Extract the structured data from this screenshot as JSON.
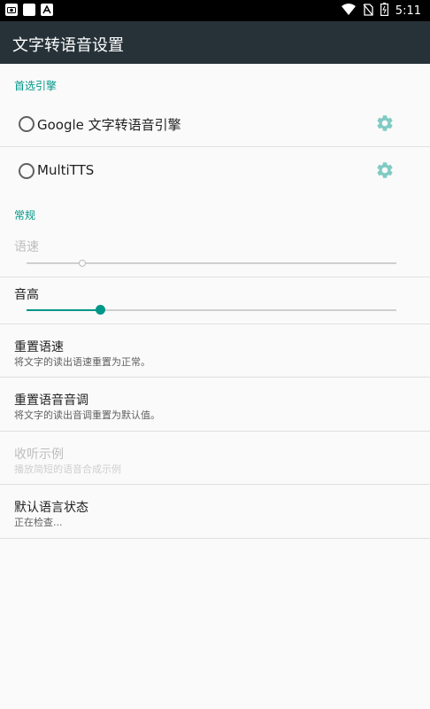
{
  "status_bar": {
    "time": "5:11",
    "left_icons": [
      "camera-icon",
      "square-icon",
      "a-icon"
    ],
    "right_icons": [
      "wifi-icon",
      "no-sim-icon",
      "battery-icon"
    ]
  },
  "toolbar": {
    "title": "文字转语音设置"
  },
  "preferred_engine": {
    "header": "首选引擎",
    "engines": [
      {
        "label": "Google 文字转语音引擎",
        "selected": false
      },
      {
        "label": "MultiTTS",
        "selected": false
      }
    ]
  },
  "general": {
    "header": "常规",
    "speech_rate": {
      "title": "语速",
      "enabled": false,
      "level": 0.15
    },
    "pitch": {
      "title": "音高",
      "enabled": true,
      "level": 0.2
    },
    "reset_rate": {
      "title": "重置语速",
      "summary": "将文字的读出语速重置为正常。"
    },
    "reset_pitch": {
      "title": "重置语音音调",
      "summary": "将文字的读出音调重置为默认值。"
    },
    "listen_example": {
      "title": "收听示例",
      "summary": "播放简短的语音合成示例",
      "enabled": false
    },
    "language_status": {
      "title": "默认语言状态",
      "summary": "正在检查..."
    }
  },
  "colors": {
    "accent": "#009688",
    "toolbar": "#263238",
    "gear": "#80cbc4"
  }
}
